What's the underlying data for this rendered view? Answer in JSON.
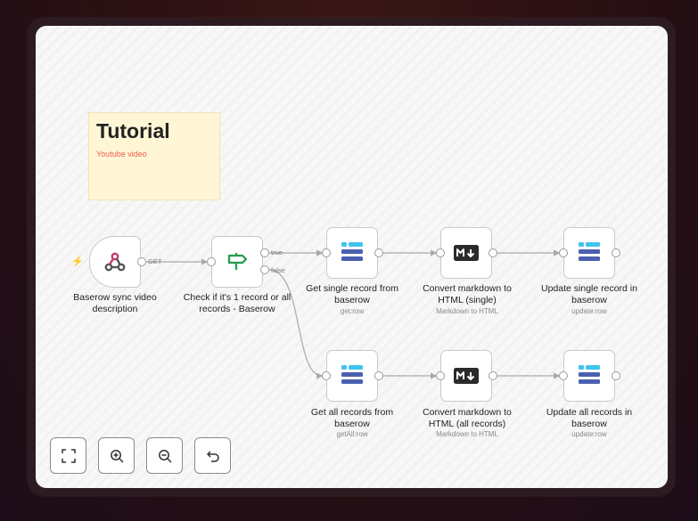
{
  "sticky": {
    "title": "Tutorial",
    "link": "Youtube video"
  },
  "nodes": {
    "trigger": {
      "label": "Baserow sync video description",
      "icon": "webhook-icon"
    },
    "if": {
      "label": "Check if it's 1 record or all records - Baserow",
      "icon": "signpost-icon"
    },
    "get_single": {
      "label": "Get single record from baserow",
      "sub": "get:row",
      "icon": "baserow-icon"
    },
    "md_single": {
      "label": "Convert markdown to HTML (single)",
      "sub": "Markdown to HTML",
      "icon": "markdown-icon"
    },
    "update_single": {
      "label": "Update single record in baserow",
      "sub": "update:row",
      "icon": "baserow-icon"
    },
    "get_all": {
      "label": "Get all records from baserow",
      "sub": "getAll:row",
      "icon": "baserow-icon"
    },
    "md_all": {
      "label": "Convert markdown to HTML (all records)",
      "sub": "Markdown to HTML",
      "icon": "markdown-icon"
    },
    "update_all": {
      "label": "Update all records in baserow",
      "sub": "update:row",
      "icon": "baserow-icon"
    }
  },
  "edge_labels": {
    "get": "GET",
    "true": "true",
    "false": "false"
  },
  "controls": {
    "fit": "fit-view-icon",
    "zoom_in": "zoom-in-icon",
    "zoom_out": "zoom-out-icon",
    "undo": "undo-icon"
  },
  "colors": {
    "baserow_light": "#3fc4ee",
    "baserow_dark": "#4a5fb0",
    "if_green": "#1f9d4b",
    "webhook_red": "#c73a63",
    "trigger_bolt": "#f0604c",
    "sticky_bg": "#fff6d6"
  }
}
